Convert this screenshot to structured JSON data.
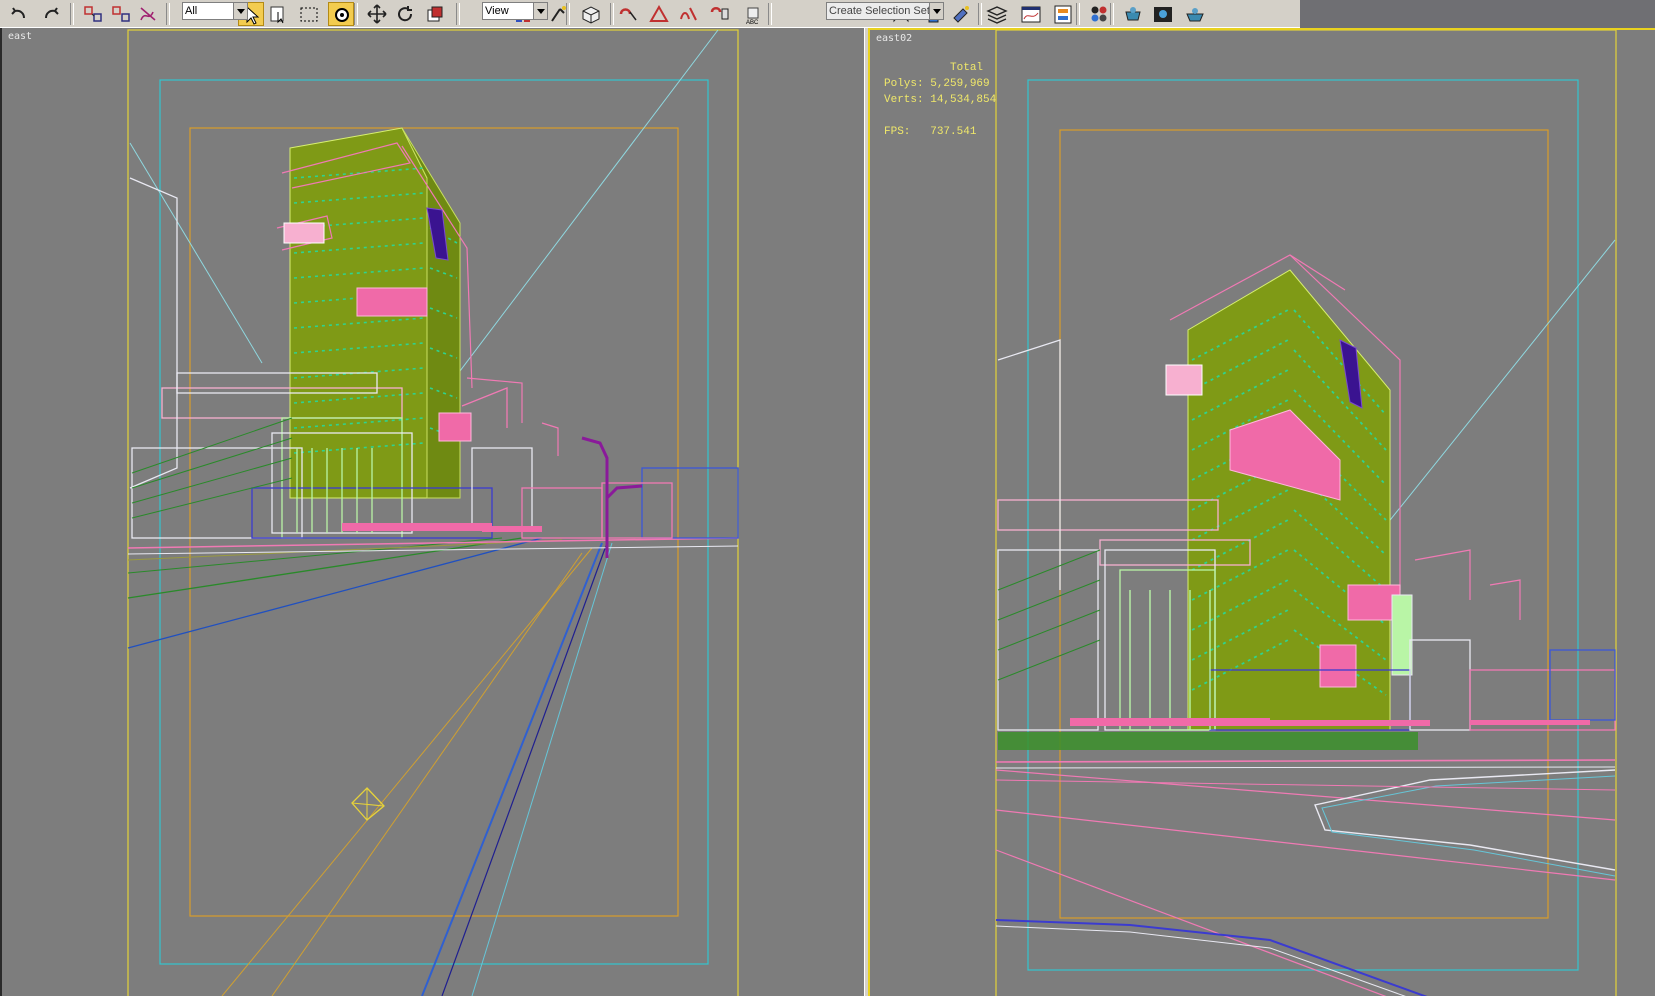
{
  "toolbar": {
    "selection_filter": "All",
    "reference_coordinate": "View",
    "named_selection_placeholder": "Create Selection Set",
    "buttons": [
      {
        "icon": "undo-icon"
      },
      {
        "icon": "redo-icon"
      },
      {
        "icon": "select-and-link-icon"
      },
      {
        "icon": "unlink-selection-icon"
      },
      {
        "icon": "bind-to-space-warp-icon"
      },
      {
        "icon": "select-object-icon",
        "active": true
      },
      {
        "icon": "select-by-name-icon"
      },
      {
        "icon": "rectangular-selection-region-icon"
      },
      {
        "icon": "window-crossing-icon",
        "active": true
      },
      {
        "icon": "select-and-move-icon"
      },
      {
        "icon": "select-and-rotate-icon"
      },
      {
        "icon": "select-and-scale-icon"
      },
      {
        "icon": "use-pivot-center-icon"
      },
      {
        "icon": "select-and-manipulate-icon"
      },
      {
        "icon": "keyboard-shortcut-override-icon"
      },
      {
        "icon": "snaps-toggle-icon"
      },
      {
        "icon": "angle-snap-toggle-icon"
      },
      {
        "icon": "percent-snap-toggle-icon"
      },
      {
        "icon": "spinner-snap-toggle-icon"
      },
      {
        "icon": "edit-named-selection-icon"
      },
      {
        "icon": "mirror-icon"
      },
      {
        "icon": "align-icon"
      },
      {
        "icon": "place-highlight-icon"
      },
      {
        "icon": "layer-manager-icon"
      },
      {
        "icon": "curve-editor-icon"
      },
      {
        "icon": "schematic-view-icon"
      },
      {
        "icon": "material-editor-icon"
      },
      {
        "icon": "render-setup-icon"
      },
      {
        "icon": "rendered-frame-window-icon"
      },
      {
        "icon": "quick-render-icon"
      }
    ]
  },
  "viewports": [
    {
      "label": "east"
    },
    {
      "label": "east02",
      "stats": {
        "header": "Total",
        "polys_label": "Polys:",
        "polys_value": "5,259,969",
        "verts_label": "Verts:",
        "verts_value": "14,534,854",
        "fps_label": "FPS:",
        "fps_value": "737.541"
      }
    }
  ],
  "colors": {
    "viewport_bg": "#7d7d7d",
    "active_border": "#e9d21f",
    "safe_frame_outer": "#e2d23a",
    "safe_frame_action": "#33c5cf",
    "safe_frame_title": "#d89d2a",
    "building_wire": "#7f9a16",
    "building_window": "#2fd38e",
    "structure_pink": "#f07ab4",
    "structure_white": "#e9e9f2",
    "glass_light_green": "#b9f5a6",
    "accent_purple": "#5a1ea0",
    "street_lamp": "#8a1a9a",
    "stats_text": "#f0e86a"
  }
}
